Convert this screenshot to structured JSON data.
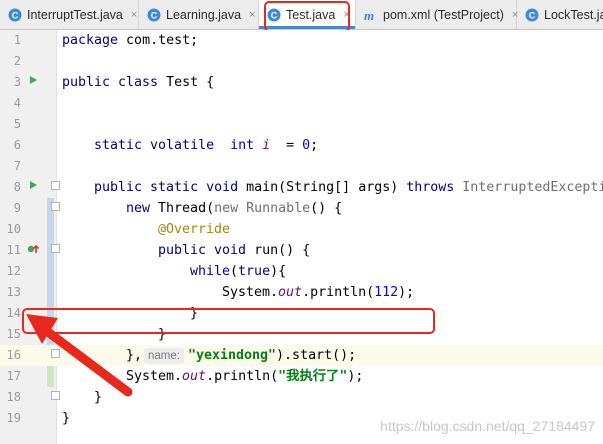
{
  "tabs": [
    {
      "label": "InterruptTest.java",
      "icon": "java-class-icon",
      "active": false
    },
    {
      "label": "Learning.java",
      "icon": "java-class-icon",
      "active": false
    },
    {
      "label": "Test.java",
      "icon": "java-class-icon",
      "active": true
    },
    {
      "label": "pom.xml (TestProject)",
      "icon": "maven-icon",
      "active": false
    },
    {
      "label": "LockTest.ja",
      "icon": "java-class-icon",
      "active": false
    }
  ],
  "tab_close_glyph": "×",
  "lines": [
    {
      "n": "1"
    },
    {
      "n": "2"
    },
    {
      "n": "3"
    },
    {
      "n": "4"
    },
    {
      "n": "5"
    },
    {
      "n": "6"
    },
    {
      "n": "7"
    },
    {
      "n": "8"
    },
    {
      "n": "9"
    },
    {
      "n": "10"
    },
    {
      "n": "11"
    },
    {
      "n": "12"
    },
    {
      "n": "13"
    },
    {
      "n": "14"
    },
    {
      "n": "15"
    },
    {
      "n": "16"
    },
    {
      "n": "17"
    },
    {
      "n": "18"
    },
    {
      "n": "19"
    }
  ],
  "code": {
    "l1_kw": "package",
    "l1_rest": " com.test;",
    "l3_kw": "public class",
    "l3_rest": " Test {",
    "l6_kw": "static volatile  int",
    "l6_var": " i",
    "l6_eq": "  = ",
    "l6_num": "0",
    "l6_end": ";",
    "l8_kw": "public static void",
    "l8_rest": " main(String[] args) ",
    "l8_kw2": "throws",
    "l8_gray": " InterruptedExcepti",
    "l9_kw": "new",
    "l9_a": " Thread(",
    "l9_gray": "new Runnable",
    "l9_b": "() {",
    "l10_ann": "@Override",
    "l11_kw": "public void",
    "l11_rest": " run() {",
    "l12_kw": "while",
    "l12_a": "(",
    "l12_kw2": "true",
    "l12_b": "){",
    "l13_a": "System.",
    "l13_out": "out",
    "l13_b": ".println(",
    "l13_num": "112",
    "l13_c": ");",
    "l14": "}",
    "l15": "}",
    "l16_a": "},",
    "l16_hint": "name:",
    "l16_str": "\"yexindong\"",
    "l16_b": ").start();",
    "l17_a": "System.",
    "l17_out": "out",
    "l17_b": ".println(",
    "l17_str": "\"我执行了\"",
    "l17_c": ");",
    "l18": "}",
    "l19": "}"
  },
  "watermark": "https://blog.csdn.net/qq_27184497",
  "colors": {
    "annotation_red": "#e8281c",
    "active_tab_underline": "#4a88c7",
    "keyword": "#000080",
    "string": "#067d17",
    "number": "#0000ff"
  }
}
